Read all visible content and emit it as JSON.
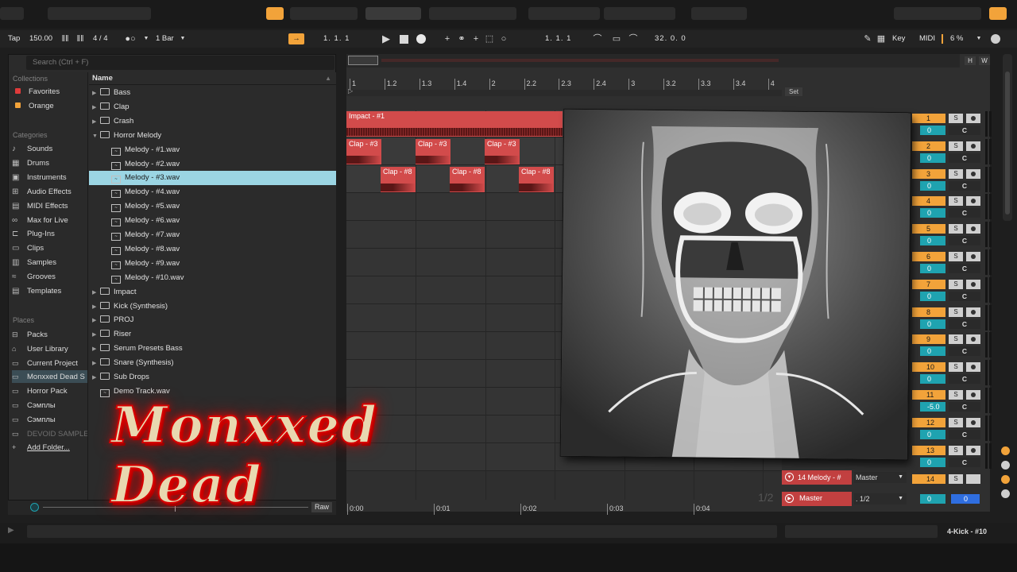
{
  "transport": {
    "tap": "Tap",
    "tempo": "150.00",
    "time_sig": "4 / 4",
    "quantize": "1 Bar",
    "position": "1.  1.  1",
    "loop_start": "1.  1.  1",
    "loop_length": "32.  0.  0",
    "key": "Key",
    "midi": "MIDI",
    "cpu": "6 %"
  },
  "browser": {
    "search_placeholder": "Search (Ctrl + F)",
    "collections_head": "Collections",
    "collections": [
      {
        "label": "Favorites",
        "color": "#e03b3b"
      },
      {
        "label": "Orange",
        "color": "#f2a33a"
      }
    ],
    "categories_head": "Categories",
    "categories": [
      "Sounds",
      "Drums",
      "Instruments",
      "Audio Effects",
      "MIDI Effects",
      "Max for Live",
      "Plug-Ins",
      "Clips",
      "Samples",
      "Grooves",
      "Templates"
    ],
    "places_head": "Places",
    "places": [
      "Packs",
      "User Library",
      "Current Project",
      "Monxxed Dead S",
      "Horror Pack",
      "Сэмплы",
      "Сэмплы",
      "DEVOID SAMPLE",
      "Add Folder..."
    ],
    "name_header": "Name",
    "files": [
      {
        "label": "Bass",
        "type": "folder",
        "indent": 0
      },
      {
        "label": "Clap",
        "type": "folder",
        "indent": 0
      },
      {
        "label": "Crash",
        "type": "folder",
        "indent": 0
      },
      {
        "label": "Horror Melody",
        "type": "folder-open",
        "indent": 0
      },
      {
        "label": "Melody - #1.wav",
        "type": "wav",
        "indent": 1
      },
      {
        "label": "Melody - #2.wav",
        "type": "wav",
        "indent": 1
      },
      {
        "label": "Melody - #3.wav",
        "type": "wav",
        "indent": 1,
        "selected": true
      },
      {
        "label": "Melody - #4.wav",
        "type": "wav",
        "indent": 1
      },
      {
        "label": "Melody - #5.wav",
        "type": "wav",
        "indent": 1
      },
      {
        "label": "Melody - #6.wav",
        "type": "wav",
        "indent": 1
      },
      {
        "label": "Melody - #7.wav",
        "type": "wav",
        "indent": 1
      },
      {
        "label": "Melody - #8.wav",
        "type": "wav",
        "indent": 1
      },
      {
        "label": "Melody - #9.wav",
        "type": "wav",
        "indent": 1
      },
      {
        "label": "Melody - #10.wav",
        "type": "wav",
        "indent": 1
      },
      {
        "label": "Impact",
        "type": "folder",
        "indent": 0
      },
      {
        "label": "Kick (Synthesis)",
        "type": "folder",
        "indent": 0
      },
      {
        "label": "PROJ",
        "type": "folder",
        "indent": 0
      },
      {
        "label": "Riser",
        "type": "folder",
        "indent": 0
      },
      {
        "label": "Serum Presets Bass",
        "type": "folder",
        "indent": 0
      },
      {
        "label": "Snare (Synthesis)",
        "type": "folder",
        "indent": 0
      },
      {
        "label": "Sub Drops",
        "type": "folder",
        "indent": 0
      },
      {
        "label": "Demo Track.wav",
        "type": "wav",
        "indent": 0
      }
    ],
    "preview_label": "Raw"
  },
  "arrangement": {
    "overview_h": "H",
    "overview_w": "W",
    "ruler": [
      "1",
      "1.2",
      "1.3",
      "1.4",
      "2",
      "2.2",
      "2.3",
      "2.4",
      "3",
      "3.2",
      "3.3",
      "3.4",
      "4"
    ],
    "set_label": "Set",
    "impact_clip": "Impact - #1",
    "clap3_clips": [
      "Clap - #3",
      "Clap - #3",
      "Clap - #3"
    ],
    "clap8_clips": [
      "Clap - #8",
      "Clap - #8",
      "Clap - #8"
    ],
    "time": [
      "0:00",
      "0:01",
      "0:02",
      "0:03",
      "0:04"
    ],
    "page": "1/2"
  },
  "mixer": {
    "tracks": [
      {
        "n": "1",
        "vol": "0"
      },
      {
        "n": "2",
        "vol": "0"
      },
      {
        "n": "3",
        "vol": "0"
      },
      {
        "n": "4",
        "vol": "0"
      },
      {
        "n": "5",
        "vol": "0"
      },
      {
        "n": "6",
        "vol": "0"
      },
      {
        "n": "7",
        "vol": "0"
      },
      {
        "n": "8",
        "vol": "0"
      },
      {
        "n": "9",
        "vol": "0"
      },
      {
        "n": "10",
        "vol": "0"
      },
      {
        "n": "11",
        "vol": "-5.0"
      },
      {
        "n": "12",
        "vol": "0"
      },
      {
        "n": "13",
        "vol": "0"
      }
    ],
    "solo": "S",
    "center": "C",
    "melody_track": "14 Melody - #",
    "melody_out": "Master",
    "track14": "14",
    "master": "Master",
    "master_out": ". 1/2",
    "master_vol": "0",
    "master_vol2": "0"
  },
  "status": {
    "selected": "4-Kick - #10"
  },
  "overlay": {
    "title": "Monxxed Dead"
  }
}
